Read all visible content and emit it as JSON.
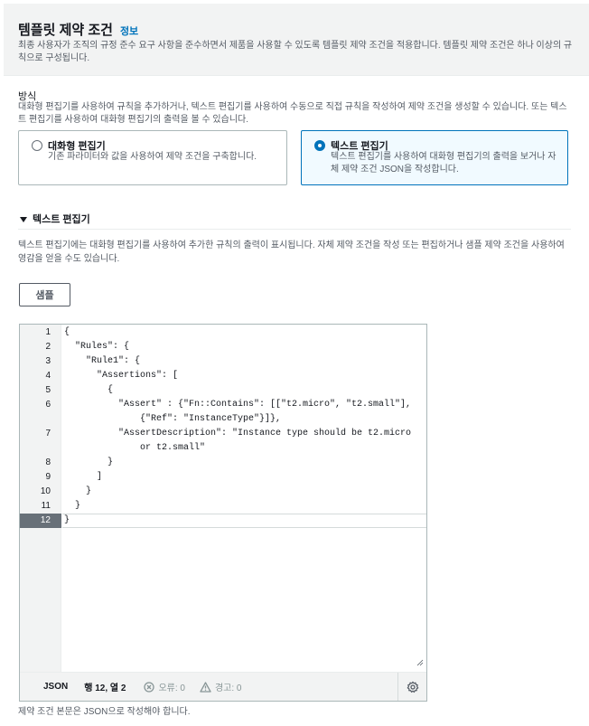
{
  "header": {
    "title": "템플릿 제약 조건",
    "info_link": "정보",
    "description": "최종 사용자가 조직의 규정 준수 요구 사항을 준수하면서 제품을 사용할 수 있도록 템플릿 제약 조건을 적용합니다. 템플릿 제약 조건은 하나 이상의 규칙으로 구성됩니다."
  },
  "method": {
    "label": "방식",
    "description": "대화형 편집기를 사용하여 규칙을 추가하거나, 텍스트 편집기를 사용하여 수동으로 직접 규칙을 작성하여 제약 조건을 생성할 수 있습니다. 또는 텍스트 편집기를 사용하여 대화형 편집기의 출력을 볼 수 있습니다.",
    "options": [
      {
        "title": "대화형 편집기",
        "description": "기존 파라미터와 값을 사용하여 제약 조건을 구축합니다.",
        "selected": false
      },
      {
        "title": "텍스트 편집기",
        "description": "텍스트 편집기를 사용하여 대화형 편집기의 출력을 보거나 자체 제약 조건 JSON을 작성합니다.",
        "selected": true
      }
    ]
  },
  "text_editor_section": {
    "title": "텍스트 편집기",
    "description": "텍스트 편집기에는 대화형 편집기를 사용하여 추가한 규칙의 출력이 표시됩니다. 자체 제약 조건을 작성 또는 편집하거나 샘플 제약 조건을 사용하여 영감을 얻을 수도 있습니다.",
    "sample_button": "샘플"
  },
  "editor": {
    "lines": [
      {
        "num": "1",
        "text": "{"
      },
      {
        "num": "2",
        "text": "  \"Rules\": {"
      },
      {
        "num": "3",
        "text": "    \"Rule1\": {"
      },
      {
        "num": "4",
        "text": "      \"Assertions\": ["
      },
      {
        "num": "5",
        "text": "        {"
      },
      {
        "num": "6",
        "text": "          \"Assert\" : {\"Fn::Contains\": [[\"t2.micro\", \"t2.small\"],"
      },
      {
        "num": "",
        "text": "              {\"Ref\": \"InstanceType\"}]},"
      },
      {
        "num": "7",
        "text": "          \"AssertDescription\": \"Instance type should be t2.micro"
      },
      {
        "num": "",
        "text": "              or t2.small\""
      },
      {
        "num": "8",
        "text": "        }"
      },
      {
        "num": "9",
        "text": "      ]"
      },
      {
        "num": "10",
        "text": "    }"
      },
      {
        "num": "11",
        "text": "  }"
      },
      {
        "num": "12",
        "text": "}"
      }
    ],
    "active_line": "12",
    "status": {
      "language": "JSON",
      "position": "행 12, 열 2",
      "errors": "오류: 0",
      "warnings": "경고: 0"
    }
  },
  "footer_note": "제약 조건 본문은 JSON으로 작성해야 합니다."
}
